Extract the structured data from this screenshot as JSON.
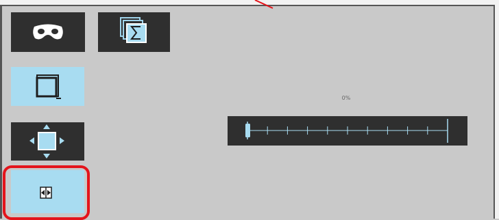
{
  "toolbar": {
    "buttons": [
      {
        "name": "mask-button",
        "icon": "mask-icon",
        "state": "normal"
      },
      {
        "name": "sum-button",
        "icon": "sigma-stack-icon",
        "state": "normal"
      },
      {
        "name": "window-button",
        "icon": "window-icon",
        "state": "active"
      },
      {
        "name": "move-button",
        "icon": "move-arrows-icon",
        "state": "normal"
      },
      {
        "name": "split-button",
        "icon": "split-arrows-icon",
        "state": "active"
      }
    ]
  },
  "slider": {
    "value_label": "0%",
    "value": 0,
    "tick_count": 11
  },
  "colors": {
    "panel_bg": "#c9c9c9",
    "button_dark": "#2f2f2f",
    "button_active": "#a8dcf1",
    "highlight": "#e4141b"
  }
}
